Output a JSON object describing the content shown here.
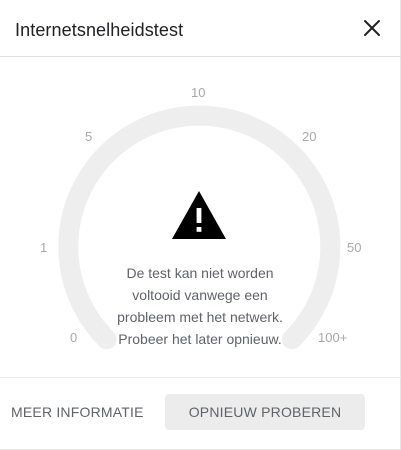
{
  "dialog": {
    "title": "Internetsnelheidstest",
    "close_icon": "close-icon"
  },
  "gauge": {
    "ticks": [
      "0",
      "1",
      "5",
      "10",
      "20",
      "50",
      "100+"
    ],
    "track_color": "#eeeeee"
  },
  "status": {
    "icon": "warning-icon",
    "message_lines": [
      "De test kan niet worden",
      "voltooid vanwege een",
      "probleem met het netwerk.",
      "Probeer het later opnieuw."
    ]
  },
  "footer": {
    "more_info_label": "MEER INFORMATIE",
    "retry_label": "OPNIEUW PROBEREN"
  }
}
